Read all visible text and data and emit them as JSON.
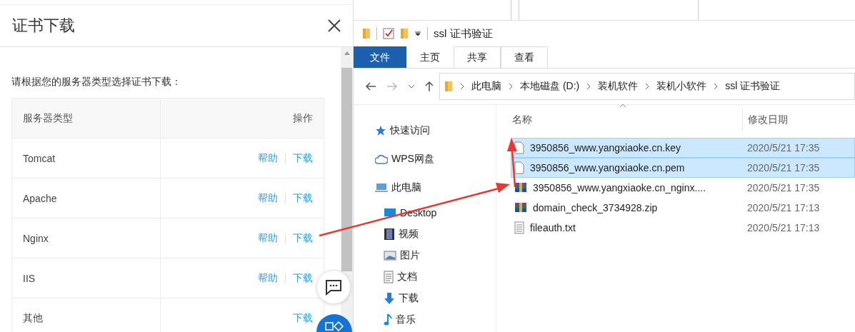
{
  "dialog": {
    "title": "证书下载",
    "instruction": "请根据您的服务器类型选择证书下载：",
    "columns": [
      "服务器类型",
      "操作"
    ],
    "rows": [
      {
        "server": "Tomcat",
        "actions": [
          "帮助",
          "下载"
        ]
      },
      {
        "server": "Apache",
        "actions": [
          "帮助",
          "下载"
        ]
      },
      {
        "server": "Nginx",
        "actions": [
          "帮助",
          "下载"
        ]
      },
      {
        "server": "IIS",
        "actions": [
          "帮助",
          "下载"
        ]
      },
      {
        "server": "其他",
        "actions": [
          "下载"
        ]
      }
    ]
  },
  "explorer": {
    "title": "ssl 证书验证",
    "ribbon_tabs": [
      {
        "label": "文件",
        "selected": true
      },
      {
        "label": "主页",
        "selected": false
      },
      {
        "label": "共享",
        "selected": false
      },
      {
        "label": "查看",
        "selected": false
      }
    ],
    "breadcrumb": [
      "此电脑",
      "本地磁盘 (D:)",
      "装机软件",
      "装机小软件",
      "ssl 证书验证"
    ],
    "nav_items": [
      {
        "label": "快速访问",
        "kind": "star"
      },
      {
        "label": "WPS网盘",
        "kind": "cloud"
      },
      {
        "label": "此电脑",
        "kind": "pc",
        "children": [
          {
            "label": "Desktop",
            "kind": "desktop"
          },
          {
            "label": "视频",
            "kind": "video"
          },
          {
            "label": "图片",
            "kind": "picture"
          },
          {
            "label": "文档",
            "kind": "document"
          },
          {
            "label": "下载",
            "kind": "download"
          },
          {
            "label": "音乐",
            "kind": "music"
          }
        ]
      }
    ],
    "columns": [
      "名称",
      "修改日期"
    ],
    "files": [
      {
        "name": "3950856_www.yangxiaoke.cn.key",
        "modified": "2020/5/21 17:35",
        "kind": "file",
        "selected": true
      },
      {
        "name": "3950856_www.yangxiaoke.cn.pem",
        "modified": "2020/5/21 17:35",
        "kind": "file",
        "selected": true
      },
      {
        "name": "3950856_www.yangxiaoke.cn_nginx....",
        "modified": "2020/5/21 17:35",
        "kind": "archive",
        "selected": false
      },
      {
        "name": "domain_check_3734928.zip",
        "modified": "2020/5/21 17:13",
        "kind": "archive",
        "selected": false
      },
      {
        "name": "fileauth.txt",
        "modified": "2020/5/21 17:13",
        "kind": "text",
        "selected": false
      }
    ]
  }
}
